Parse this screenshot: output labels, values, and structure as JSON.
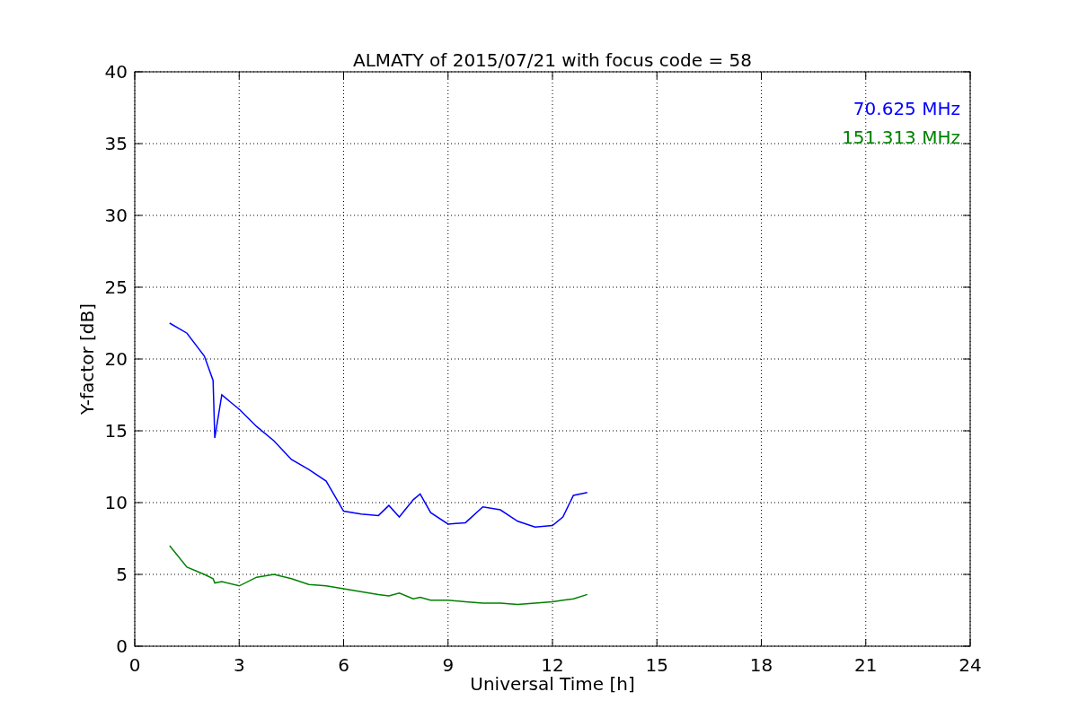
{
  "chart_data": {
    "type": "line",
    "title": "ALMATY of 2015/07/21 with focus code = 58",
    "xlabel": "Universal Time [h]",
    "ylabel": "Y-factor [dB]",
    "x": [
      1,
      1.5,
      2,
      2.25,
      2.3,
      2.5,
      3,
      3.5,
      4,
      4.5,
      5,
      5.5,
      6,
      6.5,
      7,
      7.3,
      7.6,
      8,
      8.2,
      8.5,
      9,
      9.5,
      10,
      10.5,
      11,
      11.5,
      12,
      12.3,
      12.6,
      13
    ],
    "series": [
      {
        "name": "70.625 MHz",
        "color": "#0000ff",
        "values": [
          22.5,
          21.8,
          20.2,
          18.5,
          14.5,
          17.5,
          16.5,
          15.3,
          14.3,
          13.0,
          12.3,
          11.5,
          9.4,
          9.2,
          9.1,
          9.8,
          9.0,
          10.2,
          10.6,
          9.3,
          8.5,
          8.6,
          9.7,
          9.5,
          8.7,
          8.3,
          8.4,
          9.0,
          10.5,
          10.7
        ]
      },
      {
        "name": "151.313 MHz",
        "color": "#008000",
        "values": [
          7.0,
          5.5,
          5.0,
          4.7,
          4.4,
          4.5,
          4.2,
          4.8,
          5.0,
          4.7,
          4.3,
          4.2,
          4.0,
          3.8,
          3.6,
          3.5,
          3.7,
          3.3,
          3.4,
          3.2,
          3.2,
          3.1,
          3.0,
          3.0,
          2.9,
          3.0,
          3.1,
          3.2,
          3.3,
          3.6
        ]
      }
    ],
    "xlim": [
      0,
      24
    ],
    "ylim": [
      0,
      40
    ],
    "xticks": [
      0,
      3,
      6,
      9,
      12,
      15,
      18,
      21,
      24
    ],
    "yticks": [
      0,
      5,
      10,
      15,
      20,
      25,
      30,
      35,
      40
    ],
    "grid": true
  }
}
